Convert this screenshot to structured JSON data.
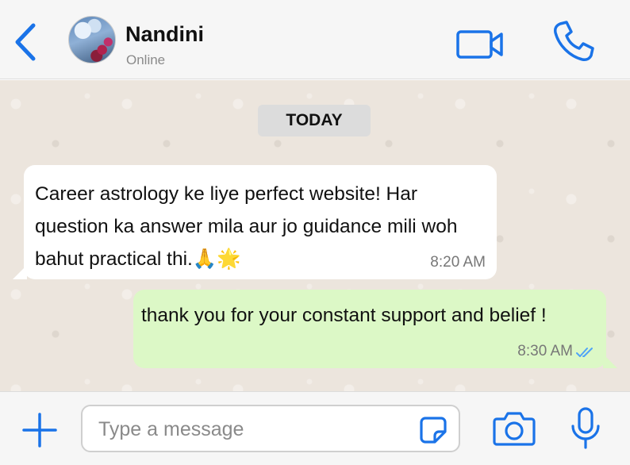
{
  "header": {
    "contact_name": "Nandini",
    "status": "Online",
    "icons": {
      "back": "chevron-left-icon",
      "video": "video-camera-icon",
      "call": "phone-icon"
    }
  },
  "chat": {
    "date_divider": "TODAY",
    "messages": [
      {
        "direction": "incoming",
        "text": "Career astrology ke liye perfect website! Har question ka answer mila aur jo guidance mili woh bahut practical thi.🙏🌟",
        "time": "8:20 AM"
      },
      {
        "direction": "outgoing",
        "text": "thank you for your constant support and belief !",
        "time": "8:30 AM",
        "read_status": "read"
      }
    ]
  },
  "composer": {
    "placeholder": "Type a message",
    "value": "",
    "icons": {
      "attach": "plus-icon",
      "sticker": "sticker-icon",
      "camera": "camera-icon",
      "mic": "microphone-icon"
    }
  },
  "colors": {
    "accent": "#1a73e8",
    "incoming_bubble": "#ffffff",
    "outgoing_bubble": "#dcf8c6",
    "chat_background": "#ece5dd",
    "read_ticks": "#4fa3f7"
  }
}
